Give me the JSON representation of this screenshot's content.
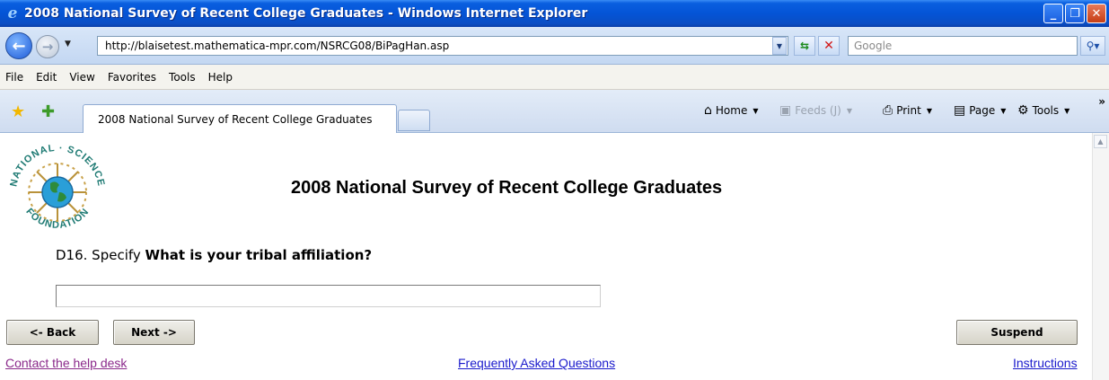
{
  "window": {
    "title": "2008 National Survey of Recent College Graduates - Windows Internet Explorer",
    "minimize": "_",
    "maximize": "❐",
    "close": "✕"
  },
  "address_bar": {
    "url": "http://blaisetest.mathematica-mpr.com/NSRCG08/BiPagHan.asp",
    "search_placeholder": "Google"
  },
  "menu": {
    "items": [
      "File",
      "Edit",
      "View",
      "Favorites",
      "Tools",
      "Help"
    ]
  },
  "tabs": {
    "active_label": "2008 National Survey of Recent College Graduates"
  },
  "command_bar": {
    "home": "Home",
    "feeds": "Feeds (J)",
    "print": "Print",
    "page": "Page",
    "tools": "Tools"
  },
  "page": {
    "logo_text_top": "NATIONAL · SCIENCE",
    "logo_text_bottom": "FOUNDATION",
    "survey_title": "2008 National Survey of Recent College Graduates",
    "question_number": "D16. Specify ",
    "question_text": "What is your tribal affiliation?",
    "answer_value": "",
    "buttons": {
      "back": "<- Back",
      "next": "Next ->",
      "suspend": "Suspend"
    },
    "links": {
      "help_desk": "Contact the help desk",
      "faq": "Frequently Asked Questions",
      "instructions": "Instructions"
    }
  },
  "colors": {
    "titlebar": "#0454d6",
    "visited_link": "#8b2a8b",
    "link": "#1a1acc"
  }
}
